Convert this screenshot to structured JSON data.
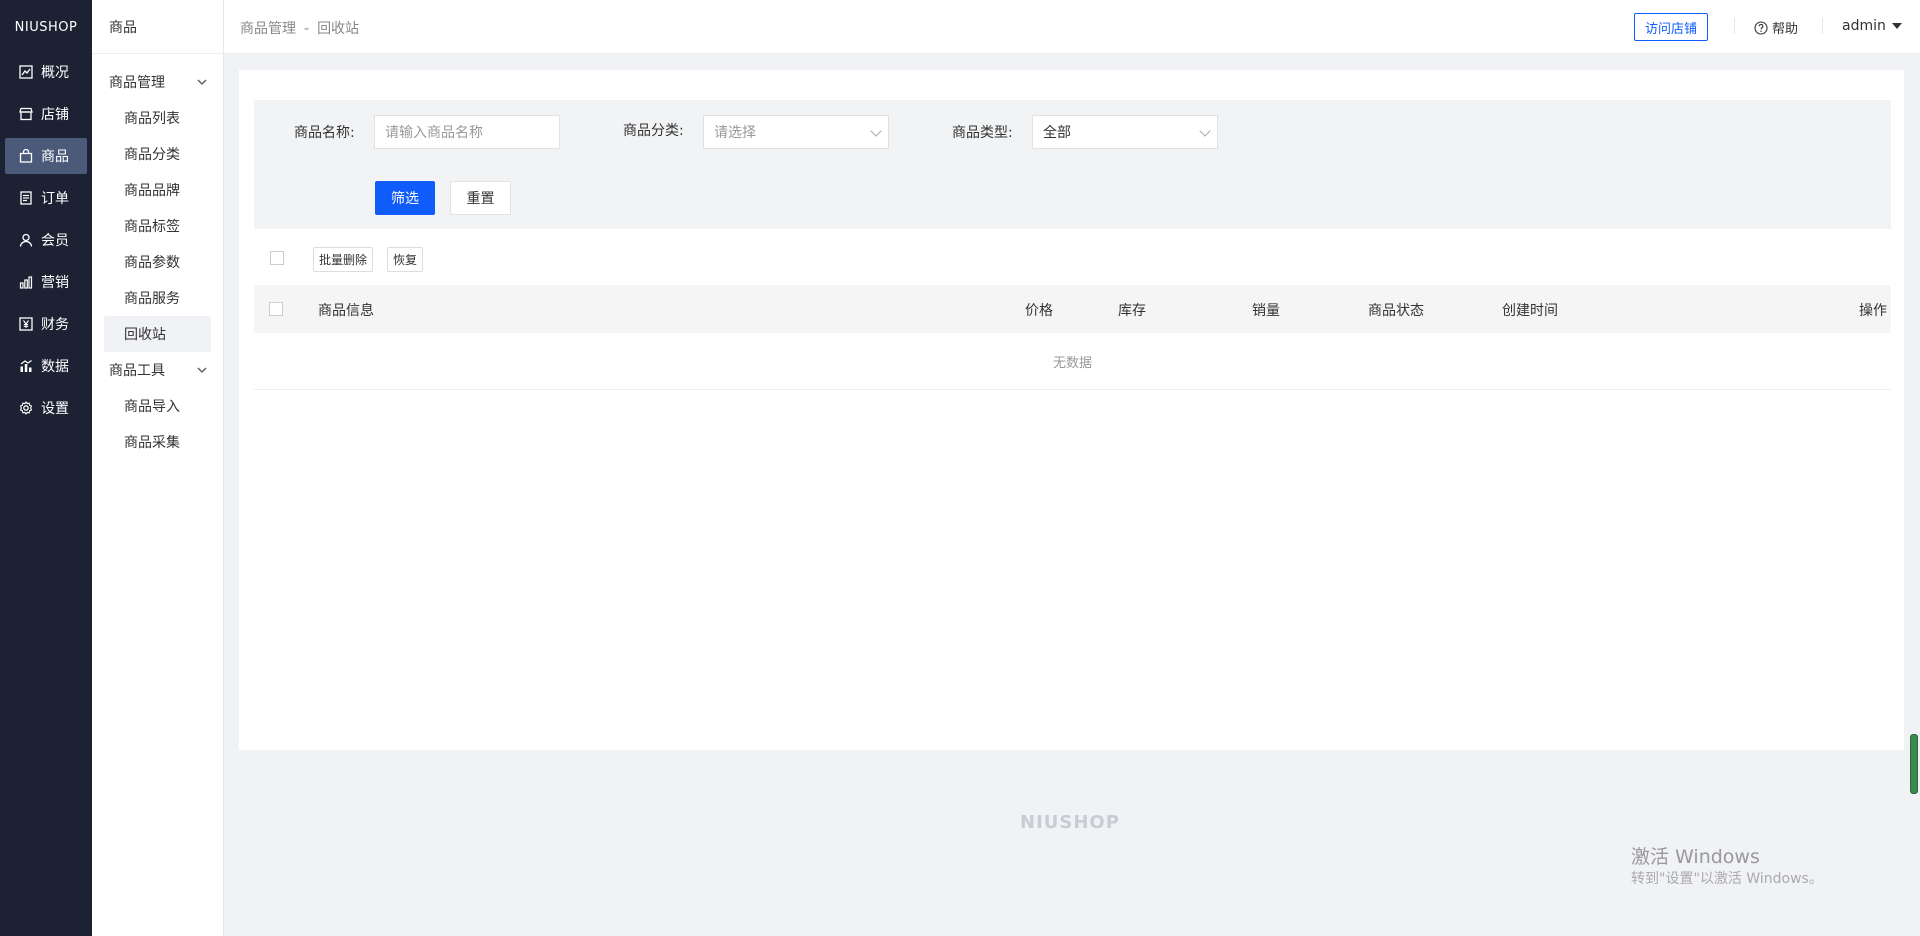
{
  "logo": "NIUSHOP",
  "primary_nav": [
    {
      "label": "概况",
      "icon": "chart-line-icon"
    },
    {
      "label": "店铺",
      "icon": "store-icon"
    },
    {
      "label": "商品",
      "icon": "bag-icon",
      "active": true
    },
    {
      "label": "订单",
      "icon": "order-icon"
    },
    {
      "label": "会员",
      "icon": "user-icon"
    },
    {
      "label": "营销",
      "icon": "bar-chart-icon"
    },
    {
      "label": "财务",
      "icon": "yen-icon"
    },
    {
      "label": "数据",
      "icon": "data-icon"
    },
    {
      "label": "设置",
      "icon": "gear-icon"
    }
  ],
  "secondary_nav": {
    "title": "商品",
    "groups": [
      {
        "label": "商品管理",
        "items": [
          "商品列表",
          "商品分类",
          "商品品牌",
          "商品标签",
          "商品参数",
          "商品服务",
          "回收站"
        ]
      },
      {
        "label": "商品工具",
        "items": [
          "商品导入",
          "商品采集"
        ]
      }
    ],
    "active_item": "回收站"
  },
  "header": {
    "breadcrumb": [
      "商品管理",
      "回收站"
    ],
    "breadcrumb_sep": "-",
    "visit_store": "访问店铺",
    "help": "帮助",
    "user": "admin"
  },
  "filter": {
    "name_label": "商品名称:",
    "name_placeholder": "请输入商品名称",
    "category_label": "商品分类:",
    "category_value": "请选择",
    "type_label": "商品类型:",
    "type_value": "全部",
    "submit": "筛选",
    "reset": "重置"
  },
  "batch": {
    "delete": "批量删除",
    "restore": "恢复"
  },
  "table": {
    "columns": [
      "商品信息",
      "价格",
      "库存",
      "销量",
      "商品状态",
      "创建时间",
      "操作"
    ],
    "empty": "无数据"
  },
  "footer_logo": "NIUSHOP",
  "windows_watermark": {
    "line1": "激活 Windows",
    "line2": "转到\"设置\"以激活 Windows。"
  },
  "colors": {
    "primary": "#105cfb",
    "sidebar_bg": "#1c2233",
    "sidebar_active": "#4c5a7a"
  }
}
